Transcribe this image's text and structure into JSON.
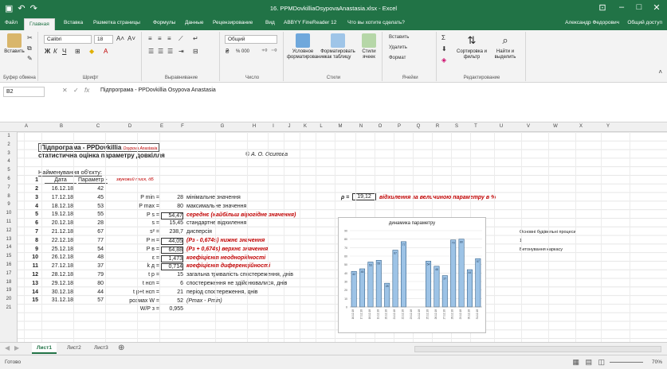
{
  "window": {
    "title": "16. PPMDovkilliaOsypovaAnastasia.xlsx - Excel",
    "qa_icons": [
      "save-icon",
      "undo-icon",
      "redo-icon"
    ],
    "brand_color": "#217346"
  },
  "tabs": [
    {
      "label": "Файл"
    },
    {
      "label": "Главная"
    },
    {
      "label": "Вставка"
    },
    {
      "label": "Разметка страницы"
    },
    {
      "label": "Формулы"
    },
    {
      "label": "Данные"
    },
    {
      "label": "Рецензирование"
    },
    {
      "label": "Вид"
    },
    {
      "label": "ABBYY FineReader 12"
    },
    {
      "label": "Что вы хотите сделать?"
    }
  ],
  "user": "Александр Федорович",
  "share_label": "Общий доступ",
  "ribbon": {
    "clipboard": {
      "paste": "Вставить",
      "label": "Буфер обмена"
    },
    "font": {
      "name": "Calibri",
      "size": "18",
      "bold": "Ж",
      "italic": "К",
      "underline": "Ч",
      "label": "Шрифт"
    },
    "alignment": {
      "label": "Выравнивание"
    },
    "number": {
      "format": "Общий",
      "percent": "% 000",
      "label": "Число"
    },
    "styles": {
      "cond": "Условное форматирование",
      "table": "Форматировать как таблицу",
      "cell": "Стили ячеек",
      "label": "Стили"
    },
    "cells": {
      "insert": "Вставить",
      "delete": "Удалить",
      "format": "Формат",
      "label": "Ячейки"
    },
    "editing": {
      "sort": "Сортировка и фильтр",
      "find": "Найти и выделить",
      "label": "Редактирование"
    }
  },
  "formula_bar": {
    "name_box": "B2",
    "formula": "Підпрограма - PPDovkillia Osypova Anastasia"
  },
  "columns": [
    "A",
    "B",
    "C",
    "D",
    "E",
    "F",
    "G",
    "H",
    "I",
    "J",
    "K",
    "L",
    "M",
    "N",
    "O",
    "P",
    "Q",
    "R",
    "S",
    "T",
    "U",
    "V",
    "W",
    "X",
    "Y"
  ],
  "rows": [
    "1",
    "2",
    "3",
    "4",
    "5",
    "6",
    "7",
    "8",
    "9",
    "10",
    "11",
    "12",
    "13",
    "14",
    "15",
    "16",
    "17",
    "18",
    "19",
    "20",
    "21"
  ],
  "sheet": {
    "title_main": "Підпрограма - PPDovkillia",
    "title_author": "Osypova Anastasia",
    "subtitle": "статистична оцінка параметру довкілля",
    "copyright": "© А. О. Осипова",
    "obj_label": "Найменування об'єкту:",
    "hdr_date": "Дата",
    "hdr_param": "Параметр -",
    "hdr_param_unit": "звуковий тиск, дБ",
    "data": [
      {
        "n": "1",
        "date": "",
        "val": ""
      },
      {
        "n": "2",
        "date": "16.12.18",
        "val": "42"
      },
      {
        "n": "3",
        "date": "17.12.18",
        "val": "45"
      },
      {
        "n": "4",
        "date": "18.12.18",
        "val": "53"
      },
      {
        "n": "5",
        "date": "19.12.18",
        "val": "55"
      },
      {
        "n": "6",
        "date": "20.12.18",
        "val": "28"
      },
      {
        "n": "7",
        "date": "21.12.18",
        "val": "67"
      },
      {
        "n": "8",
        "date": "22.12.18",
        "val": "77"
      },
      {
        "n": "9",
        "date": "25.12.18",
        "val": "54"
      },
      {
        "n": "10",
        "date": "26.12.18",
        "val": "48"
      },
      {
        "n": "11",
        "date": "27.12.18",
        "val": "37"
      },
      {
        "n": "12",
        "date": "28.12.18",
        "val": "79"
      },
      {
        "n": "13",
        "date": "29.12.18",
        "val": "80"
      },
      {
        "n": "14",
        "date": "30.12.18",
        "val": "44"
      },
      {
        "n": "15",
        "date": "31.12.18",
        "val": "57"
      }
    ],
    "stats": [
      {
        "sym": "P min =",
        "val": "28",
        "desc": "мінімальне значення",
        "red": false,
        "boxed": false,
        "ital": false
      },
      {
        "sym": "P max =",
        "val": "80",
        "desc": "максимальне значення",
        "red": false,
        "boxed": false,
        "ital": false
      },
      {
        "sym": "P s =",
        "val": "54,47",
        "desc": "середнє (найбільш вірогідне значення)",
        "red": true,
        "boxed": true,
        "ital": true
      },
      {
        "sym": "s =",
        "val": "15,45",
        "desc": "стандартне відхилення",
        "red": false,
        "boxed": false,
        "ital": false
      },
      {
        "sym": "s² =",
        "val": "238,7",
        "desc": "дисперсія",
        "red": false,
        "boxed": false,
        "ital": false
      },
      {
        "sym": "P н =",
        "val": "44,05",
        "desc": "(Pз - 0,674s) нижнє значення",
        "red": true,
        "boxed": true,
        "ital": true
      },
      {
        "sym": "P в =",
        "val": "64,88",
        "desc": "(Pз + 0,674s) верхнє значення",
        "red": true,
        "boxed": true,
        "ital": true
      },
      {
        "sym": "ε =",
        "val": "1,473",
        "desc": "коефіцієнт неоднорідності",
        "red": true,
        "boxed": true,
        "ital": true
      },
      {
        "sym": "k д =",
        "val": "0,714",
        "desc": "коефіцієнт диференційності",
        "red": true,
        "boxed": true,
        "ital": true
      },
      {
        "sym": "t р =",
        "val": "15",
        "desc": "загальна тривалість спостереження, днів",
        "red": false,
        "boxed": false,
        "ital": false
      },
      {
        "sym": "t нсп =",
        "val": "6",
        "desc": "спостереження не здійснювалися, днів",
        "red": false,
        "boxed": false,
        "ital": false
      },
      {
        "sym": "t р+t нсп =",
        "val": "21",
        "desc": "період спостереження, днів",
        "red": false,
        "boxed": false,
        "ital": false
      },
      {
        "sym": "розмах W =",
        "val": "52",
        "desc": "(Pmax - Pmin)",
        "red": false,
        "boxed": false,
        "ital": true
      },
      {
        "sym": "W/P з =",
        "val": "0,955",
        "desc": "",
        "red": false,
        "boxed": false,
        "ital": false
      }
    ],
    "rho_label": "ρ =",
    "rho_value": "19,12",
    "rho_desc": "відхилення за величиною параметру в %",
    "side_note_1": "Основні будівельні процеси",
    "side_note_2": "1",
    "side_note_3": "Бетонування каркасу"
  },
  "chart_data": {
    "type": "bar",
    "title": "динамика параметру",
    "categories": [
      "16.12.18",
      "17.12.18",
      "18.12.18",
      "19.12.18",
      "20.12.18",
      "21.12.18",
      "22.12.18",
      "23.12.18",
      "24.12.18",
      "25.12.18",
      "26.12.18",
      "27.12.18",
      "28.12.18",
      "29.12.18",
      "30.12.18",
      "31.12.18"
    ],
    "values": [
      42,
      45,
      53,
      55,
      28,
      67,
      77,
      0,
      0,
      54,
      48,
      37,
      79,
      80,
      44,
      57
    ],
    "ylim": [
      0,
      90
    ],
    "bar_color": "#9dc3e6",
    "bar_edge": "#1f4e79"
  },
  "sheet_tabs": [
    "Лист1",
    "Лист2",
    "Лист3"
  ],
  "status": "Готово",
  "zoom": "70%"
}
